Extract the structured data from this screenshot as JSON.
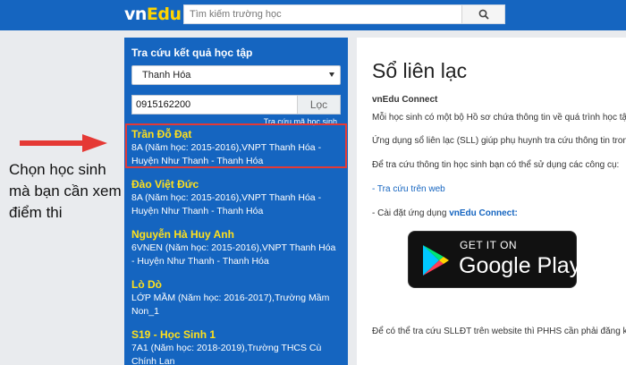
{
  "header": {
    "logo_vn": "vn",
    "logo_edu": "Edu",
    "search_placeholder": "Tìm kiếm trường học"
  },
  "annotation": {
    "text": "Chọn học sinh mà bạn cần xem điểm thi"
  },
  "lookup": {
    "title": "Tra cứu kết quả học tập",
    "province": "Thanh Hóa",
    "phone": "0915162200",
    "search_button": "Lọc",
    "help_link": "Tra cứu mã học sinh"
  },
  "students": [
    {
      "name": "Trần Đỗ Đạt",
      "info": "8A (Năm học: 2015-2016),VNPT Thanh Hóa - Huyện Như Thanh - Thanh Hóa",
      "highlighted": true
    },
    {
      "name": "Đào Việt Đức",
      "info": "8A (Năm học: 2015-2016),VNPT Thanh Hóa - Huyện Như Thanh - Thanh Hóa"
    },
    {
      "name": "Nguyễn Hà Huy Anh",
      "info": "6VNEN (Năm học: 2015-2016),VNPT Thanh Hóa - Huyện Như Thanh - Thanh Hóa"
    },
    {
      "name": "Lò Dò",
      "info": "LỚP MẦM (Năm học: 2016-2017),Trường Mầm Non_1"
    },
    {
      "name": "S19 - Học Sinh 1",
      "info": "7A1 (Năm học: 2018-2019),Trường THCS Cù Chính Lan"
    }
  ],
  "contact_book": {
    "title": "Sổ liên lạc",
    "subtitle": "vnEdu Connect",
    "line1": "Mỗi học sinh có một bộ Hồ sơ chứa thông tin về quá trình học tập",
    "line2": "Ứng dụng sổ liên lạc (SLL) giúp phụ huynh tra cứu thông tin trong",
    "line3": "Để tra cứu thông tin học sinh bạn có thể sử dụng các công cụ:",
    "web_link": "- Tra cứu trên web",
    "install_prefix": "- Cài đặt ứng dụng ",
    "install_app": "vnEdu Connect:",
    "footer": "Để có thể tra cứu SLLĐT trên website thì PHHS cần phải đăng ký"
  },
  "google_play": {
    "small": "GET IT ON",
    "big": "Google Play"
  },
  "colors": {
    "brand_blue": "#1565c0",
    "student_name_yellow": "#ffe01b",
    "highlight_red": "#e53935",
    "arrow_red": "#e53935"
  }
}
